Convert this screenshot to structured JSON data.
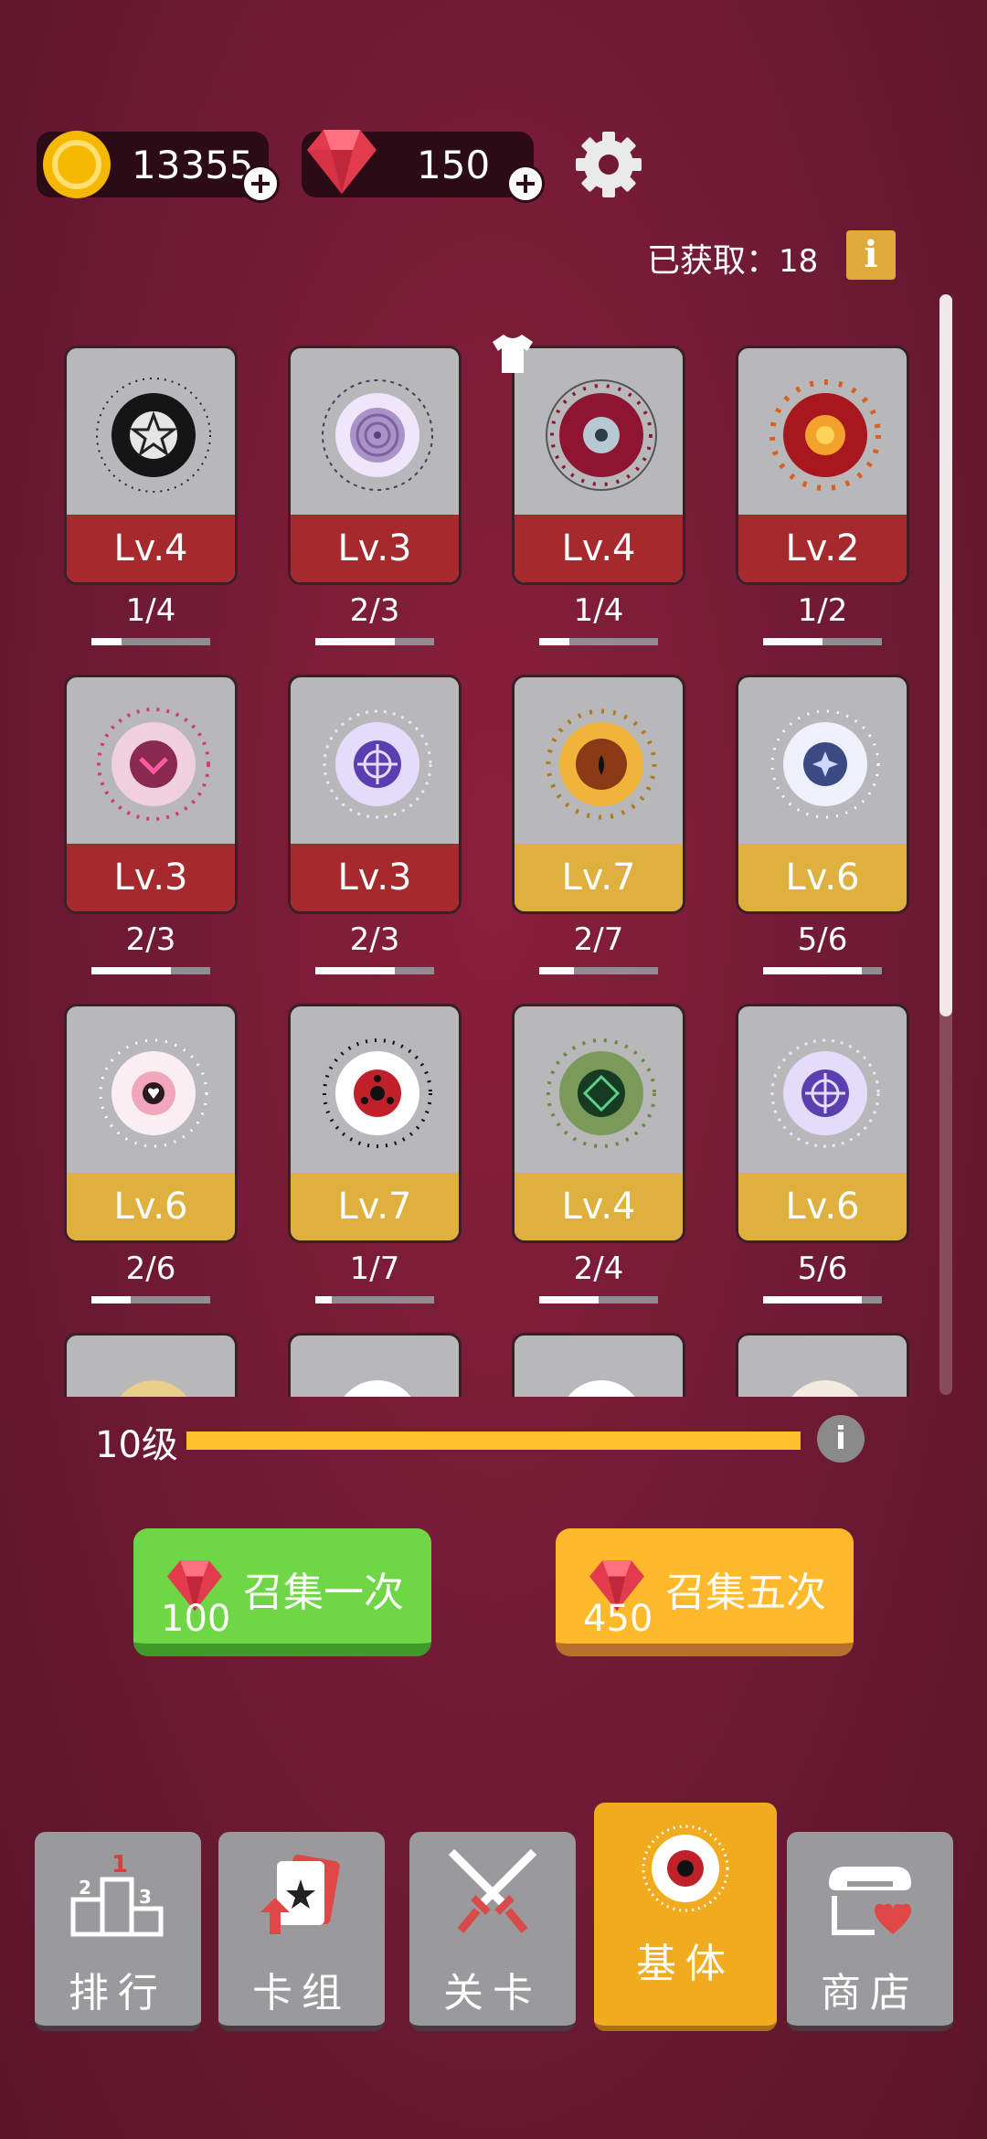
{
  "currency": {
    "coins": "13355",
    "gems": "150"
  },
  "collection": {
    "collected_label": "已获取：",
    "collected_count": "18"
  },
  "cards": [
    {
      "level": "Lv.4",
      "progress": "1/4",
      "frac": 0.25,
      "tier": "red"
    },
    {
      "level": "Lv.3",
      "progress": "2/3",
      "frac": 0.67,
      "tier": "red"
    },
    {
      "level": "Lv.4",
      "progress": "1/4",
      "frac": 0.25,
      "tier": "red"
    },
    {
      "level": "Lv.2",
      "progress": "1/2",
      "frac": 0.5,
      "tier": "red"
    },
    {
      "level": "Lv.3",
      "progress": "2/3",
      "frac": 0.67,
      "tier": "red"
    },
    {
      "level": "Lv.3",
      "progress": "2/3",
      "frac": 0.67,
      "tier": "red"
    },
    {
      "level": "Lv.7",
      "progress": "2/7",
      "frac": 0.29,
      "tier": "gold"
    },
    {
      "level": "Lv.6",
      "progress": "5/6",
      "frac": 0.83,
      "tier": "gold"
    },
    {
      "level": "Lv.6",
      "progress": "2/6",
      "frac": 0.33,
      "tier": "gold"
    },
    {
      "level": "Lv.7",
      "progress": "1/7",
      "frac": 0.14,
      "tier": "gold"
    },
    {
      "level": "Lv.4",
      "progress": "2/4",
      "frac": 0.5,
      "tier": "gold"
    },
    {
      "level": "Lv.6",
      "progress": "5/6",
      "frac": 0.83,
      "tier": "gold"
    }
  ],
  "player_level": {
    "label": "10级",
    "progress": 1.0
  },
  "summon": {
    "once_label": "召集一次",
    "once_cost": "100",
    "five_label": "召集五次",
    "five_cost": "450"
  },
  "nav": {
    "rank": "排行",
    "deck": "卡组",
    "stage": "关卡",
    "base": "基体",
    "shop": "商店"
  },
  "colors": {
    "red_tier": "#a62a2d",
    "gold_tier": "#e0b03e",
    "green_button": "#6fd645",
    "orange_button": "#ffb92a"
  }
}
